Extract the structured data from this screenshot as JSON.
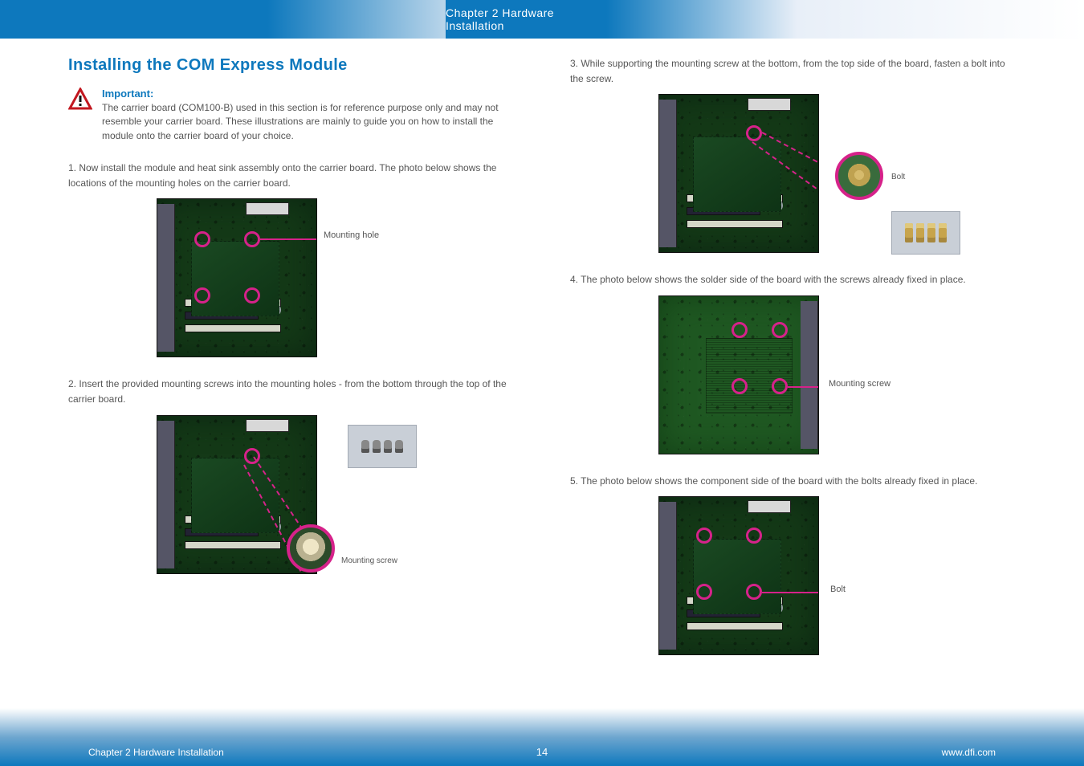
{
  "chapter_tab": "Chapter 2 Hardware Installation",
  "section_heading": "Installing the COM Express Module",
  "important": {
    "label": "Important:",
    "text": "The carrier board (COM100-B) used in this section is for reference purpose only and may not resemble your carrier board. These illustrations are mainly to guide you on how to install the module onto the carrier board of your choice."
  },
  "left": {
    "step_intro_prefix": "1. ",
    "step_intro": "Now install the module and heat sink assembly onto the carrier board. The photo below shows the locations of the mounting holes on the carrier board.",
    "fig1_callout": "Mounting hole",
    "step2_prefix": "2. ",
    "step2_text": "Insert the provided mounting screws into the mounting holes - from the bottom through the top of the carrier board.",
    "fig2_inner_label": "Mounting screw"
  },
  "right": {
    "step3_prefix": "3. ",
    "step3_text": "While supporting the mounting screw at the bottom, from the top side of the board, fasten a bolt into the screw.",
    "fig3_inner_label": "Bolt",
    "step4_prefix": "4. ",
    "step4_text": "The photo below shows the solder side of the board with the screws already fixed in place.",
    "fig4_callout": "Mounting screw",
    "step5_prefix": "5. ",
    "step5_text": "The photo below shows the component side of the board with the bolts already fixed in place.",
    "fig5_callout": "Bolt"
  },
  "footer": {
    "left": "Chapter 2 Hardware Installation",
    "page": "14",
    "right": "www.dfi.com"
  },
  "colors": {
    "accent_blue": "#0d78bd",
    "marker_pink": "#d6228a",
    "body_gray": "#565656"
  }
}
